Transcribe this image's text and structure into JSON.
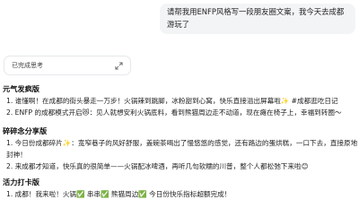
{
  "user_message": "请帮我用ENFP风格写一段朋友圈文案，我今天去成都游玩了",
  "thinking": {
    "label": "已完成思考"
  },
  "sections": [
    {
      "title": "元气发疯版",
      "items": [
        "1. 谁懂啊！在成都的街头暴走一万步！火锅辣到跳脚，冰粉甜到心窝，快乐直接溢出屏幕啦✨ #成都逛吃日记",
        "2. ENFP 的成都模式开启😻：见人就想安利火锅底料，看到熊猫周边走不动道，现在瘫在椅子上，幸福到转圈～"
      ]
    },
    {
      "title": "碎碎念分享版",
      "items": [
        "1. 今日份成都碎片✨：宽窄巷子的风好舒服，盖碗茶喝出了慢悠悠的感觉，还有路边的蛋烘糕，一口下去，直接原地封神！",
        "2. 来成都才知道，快乐真的很简单——火锅配冰啤酒，再听几句软糯的川普，整个人都松弛下来啦😊"
      ]
    },
    {
      "title": "活力打卡版",
      "items": [
        "1. 成都！我来啦！火锅✅ 串串✅ 熊猫周边✅ 今日份快乐指标超额完成！"
      ]
    }
  ]
}
